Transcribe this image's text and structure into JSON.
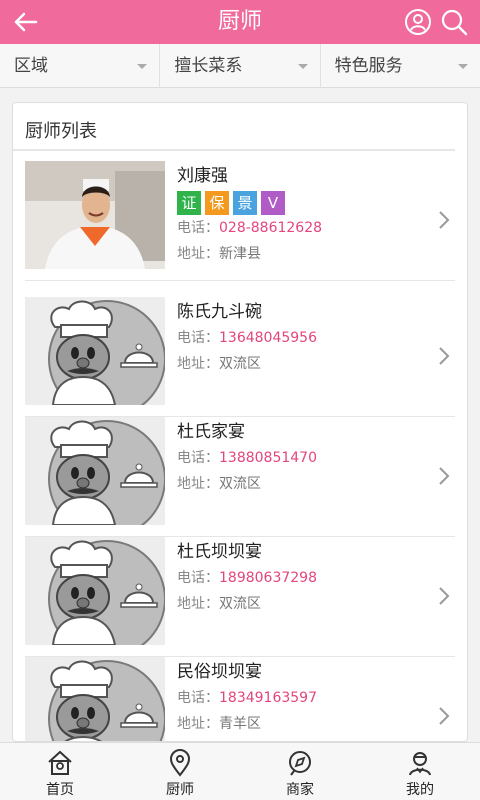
{
  "header": {
    "title": "厨师"
  },
  "filters": [
    {
      "label": "区域"
    },
    {
      "label": "擅长菜系"
    },
    {
      "label": "特色服务"
    }
  ],
  "list": {
    "title": "厨师列表",
    "items": [
      {
        "name": "刘康强",
        "phone_label": "电话：",
        "phone": "028-88612628",
        "addr_label": "地址：",
        "addr": "新津县",
        "badges": [
          {
            "text": "证",
            "color": "#2fb34a"
          },
          {
            "text": "保",
            "color": "#f39a1e"
          },
          {
            "text": "景",
            "color": "#4aa3df"
          },
          {
            "text": "V",
            "color": "#b05bc6"
          }
        ]
      },
      {
        "name": "陈氏九斗碗",
        "phone_label": "电话：",
        "phone": "13648045956",
        "addr_label": "地址：",
        "addr": "双流区"
      },
      {
        "name": "杜氏家宴",
        "phone_label": "电话：",
        "phone": "13880851470",
        "addr_label": "地址：",
        "addr": "双流区"
      },
      {
        "name": "杜氏坝坝宴",
        "phone_label": "电话：",
        "phone": "18980637298",
        "addr_label": "地址：",
        "addr": "双流区"
      },
      {
        "name": "民俗坝坝宴",
        "phone_label": "电话：",
        "phone": "18349163597",
        "addr_label": "地址：",
        "addr": "青羊区"
      }
    ]
  },
  "tabs": [
    {
      "label": "首页",
      "icon": "home-icon"
    },
    {
      "label": "厨师",
      "icon": "location-pin-icon"
    },
    {
      "label": "商家",
      "icon": "compass-icon"
    },
    {
      "label": "我的",
      "icon": "profile-icon"
    }
  ],
  "colors": {
    "brand": "#f06a9b",
    "phone": "#e4457e"
  }
}
